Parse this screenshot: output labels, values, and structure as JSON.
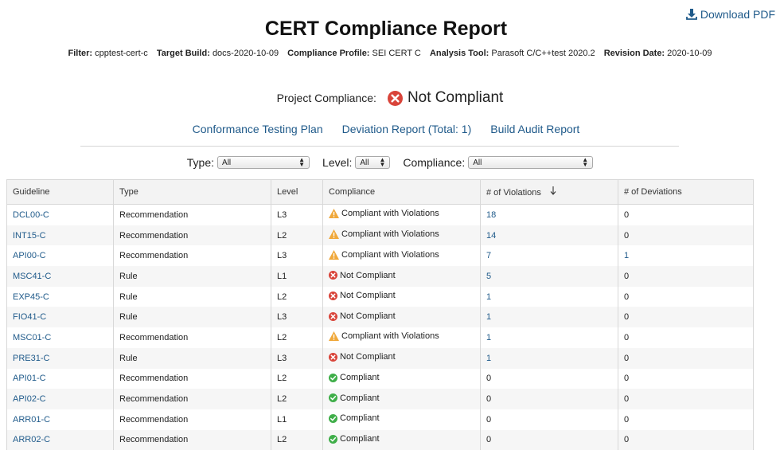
{
  "header": {
    "download_label": "Download PDF",
    "title": "CERT Compliance Report",
    "meta": [
      {
        "label": "Filter:",
        "value": "cpptest-cert-c"
      },
      {
        "label": "Target Build:",
        "value": "docs-2020-10-09"
      },
      {
        "label": "Compliance Profile:",
        "value": "SEI CERT C"
      },
      {
        "label": "Analysis Tool:",
        "value": "Parasoft C/C++test 2020.2"
      },
      {
        "label": "Revision Date:",
        "value": "2020-10-09"
      }
    ]
  },
  "project": {
    "label": "Project Compliance:",
    "status": "Not Compliant",
    "icon": "error-circle-icon"
  },
  "links": [
    "Conformance Testing Plan",
    "Deviation Report (Total: 1)",
    "Build Audit Report"
  ],
  "filters": {
    "type": {
      "label": "Type:",
      "value": "All"
    },
    "level": {
      "label": "Level:",
      "value": "All"
    },
    "compliance": {
      "label": "Compliance:",
      "value": "All"
    }
  },
  "table": {
    "columns": [
      "Guideline",
      "Type",
      "Level",
      "Compliance",
      "# of Violations",
      "# of Deviations"
    ],
    "sorted_column": "# of Violations",
    "rows": [
      {
        "guideline": "DCL00-C",
        "type": "Recommendation",
        "level": "L3",
        "compliance": "Compliant with Violations",
        "status": "warning",
        "violations": "18",
        "deviations": "0"
      },
      {
        "guideline": "INT15-C",
        "type": "Recommendation",
        "level": "L2",
        "compliance": "Compliant with Violations",
        "status": "warning",
        "violations": "14",
        "deviations": "0"
      },
      {
        "guideline": "API00-C",
        "type": "Recommendation",
        "level": "L3",
        "compliance": "Compliant with Violations",
        "status": "warning",
        "violations": "7",
        "deviations": "1"
      },
      {
        "guideline": "MSC41-C",
        "type": "Rule",
        "level": "L1",
        "compliance": "Not Compliant",
        "status": "error",
        "violations": "5",
        "deviations": "0"
      },
      {
        "guideline": "EXP45-C",
        "type": "Rule",
        "level": "L2",
        "compliance": "Not Compliant",
        "status": "error",
        "violations": "1",
        "deviations": "0"
      },
      {
        "guideline": "FIO41-C",
        "type": "Rule",
        "level": "L3",
        "compliance": "Not Compliant",
        "status": "error",
        "violations": "1",
        "deviations": "0"
      },
      {
        "guideline": "MSC01-C",
        "type": "Recommendation",
        "level": "L2",
        "compliance": "Compliant with Violations",
        "status": "warning",
        "violations": "1",
        "deviations": "0"
      },
      {
        "guideline": "PRE31-C",
        "type": "Rule",
        "level": "L3",
        "compliance": "Not Compliant",
        "status": "error",
        "violations": "1",
        "deviations": "0"
      },
      {
        "guideline": "API01-C",
        "type": "Recommendation",
        "level": "L2",
        "compliance": "Compliant",
        "status": "ok",
        "violations": "0",
        "deviations": "0"
      },
      {
        "guideline": "API02-C",
        "type": "Recommendation",
        "level": "L2",
        "compliance": "Compliant",
        "status": "ok",
        "violations": "0",
        "deviations": "0"
      },
      {
        "guideline": "ARR01-C",
        "type": "Recommendation",
        "level": "L1",
        "compliance": "Compliant",
        "status": "ok",
        "violations": "0",
        "deviations": "0"
      },
      {
        "guideline": "ARR02-C",
        "type": "Recommendation",
        "level": "L2",
        "compliance": "Compliant",
        "status": "ok",
        "violations": "0",
        "deviations": "0"
      }
    ]
  },
  "colors": {
    "link": "#1f5a8a",
    "error": "#d9443a",
    "warning": "#f0a83a",
    "ok": "#3fae49"
  }
}
